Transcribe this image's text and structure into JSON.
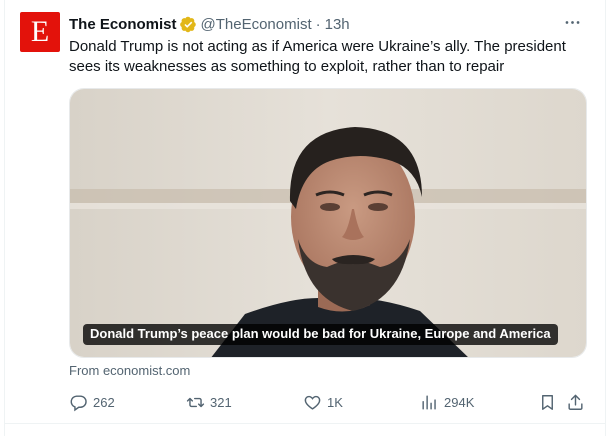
{
  "tweet": {
    "avatar_letter": "E",
    "author_name": "The Economist",
    "verified_badge": "gold-check-icon",
    "handle": "@TheEconomist",
    "separator": "·",
    "time": "13h",
    "text": "Donald Trump is not acting as if America were Ukraine’s ally. The president sees its weaknesses as something to exploit, rather than to repair",
    "card": {
      "caption": "Donald Trump’s peace plan would be bad for Ukraine, Europe and America",
      "source": "From economist.com"
    },
    "actions": {
      "replies": "262",
      "reposts": "321",
      "likes": "1K",
      "views": "294K"
    }
  },
  "colors": {
    "brand_red": "#e3120b",
    "secondary_text": "#536471",
    "badge_gold": "#e2b719"
  }
}
